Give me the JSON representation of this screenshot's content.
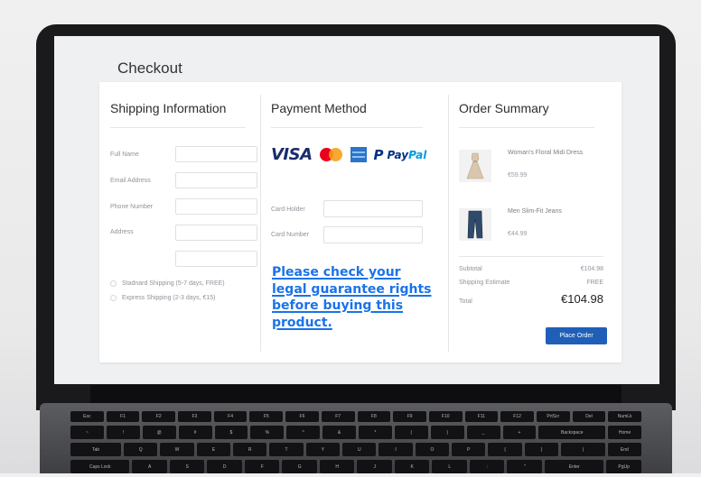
{
  "page": {
    "title": "Checkout"
  },
  "shipping": {
    "heading": "Shipping Information",
    "fields": [
      {
        "label": "Full Name",
        "value": ""
      },
      {
        "label": "Email Address",
        "value": ""
      },
      {
        "label": "Phone Number",
        "value": ""
      },
      {
        "label": "Address",
        "value": ""
      }
    ],
    "options": [
      {
        "label": "Stadnard Shipping (5-7 days, FREE)",
        "selected": false
      },
      {
        "label": "Express Shipping (2-3 days, €15)",
        "selected": false
      }
    ]
  },
  "payment": {
    "heading": "Payment Method",
    "brands": {
      "visa": "VISA",
      "paypal_a": "Pay",
      "paypal_b": "Pal",
      "paypal_icon": "P",
      "mastercard_icon": "mastercard-icon",
      "amex_icon": "amex-card-icon"
    },
    "fields": [
      {
        "label": "Card Holder",
        "value": ""
      },
      {
        "label": "Card Number",
        "value": ""
      }
    ],
    "legal_link": "Please check your legal guarantee rights before buying this product."
  },
  "summary": {
    "heading": "Order Summary",
    "items": [
      {
        "name": "Woman's Floral Midi Dress",
        "price": "€59.99",
        "icon": "dress-icon"
      },
      {
        "name": "Men Slim-Fit Jeans",
        "price": "€44.99",
        "icon": "jeans-icon"
      }
    ],
    "subtotal_label": "Subtotal",
    "subtotal_value": "€104.98",
    "shipping_label": "Shipping Estimate",
    "shipping_value": "FREE",
    "total_label": "Total",
    "total_value": "€104.98",
    "place_order": "Place Order"
  },
  "colors": {
    "link": "#1a73e8",
    "button": "#1f5fb8",
    "laptop_bezel": "#1a1a1c"
  },
  "keyboard": {
    "rows": [
      [
        "Esc",
        "F1",
        "F2",
        "F3",
        "F4",
        "F5",
        "F6",
        "F7",
        "F8",
        "F9",
        "F10",
        "F11",
        "F12",
        "PrtScr",
        "Del",
        "NumLk"
      ],
      [
        "~",
        "!",
        "@",
        "#",
        "$",
        "%",
        "^",
        "&",
        "*",
        "(",
        ")",
        "_",
        "+",
        "Backspace",
        "Home"
      ],
      [
        "Tab",
        "Q",
        "W",
        "E",
        "R",
        "T",
        "Y",
        "U",
        "I",
        "O",
        "P",
        "{",
        "}",
        "|",
        "End"
      ],
      [
        "Caps Lock",
        "A",
        "S",
        "D",
        "F",
        "G",
        "H",
        "J",
        "K",
        "L",
        ":",
        "\"",
        "Enter",
        "PgUp"
      ]
    ]
  }
}
